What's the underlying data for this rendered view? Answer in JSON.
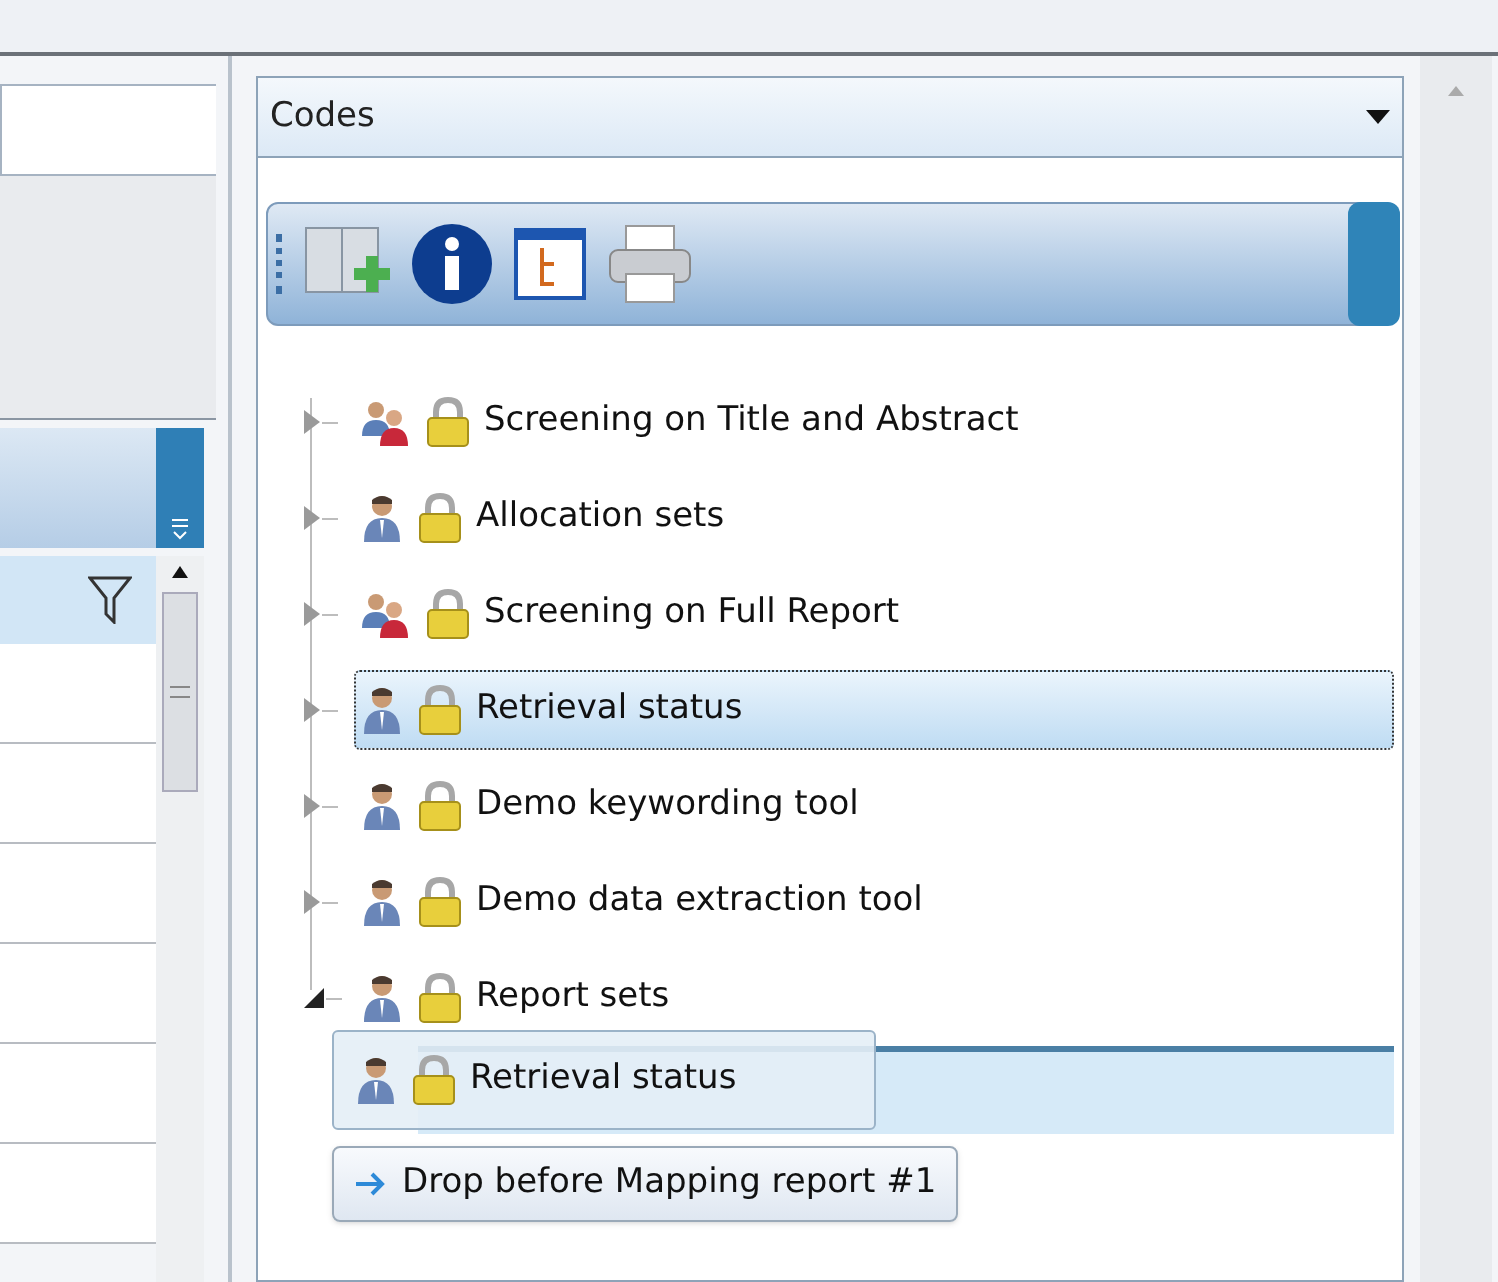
{
  "panel": {
    "title": "Codes"
  },
  "toolbar": {
    "buttons": [
      {
        "kind": "add"
      },
      {
        "kind": "info"
      },
      {
        "kind": "tree"
      },
      {
        "kind": "print"
      }
    ]
  },
  "code_sets": [
    {
      "label": "Screening on Title and Abstract",
      "kind": "multi_user",
      "locked": true,
      "selected": false,
      "expanded": false
    },
    {
      "label": "Allocation sets",
      "kind": "single_user",
      "locked": true,
      "selected": false,
      "expanded": false
    },
    {
      "label": "Screening on Full Report",
      "kind": "multi_user",
      "locked": true,
      "selected": false,
      "expanded": false
    },
    {
      "label": "Retrieval status",
      "kind": "single_user",
      "locked": true,
      "selected": true,
      "expanded": false
    },
    {
      "label": "Demo keywording tool",
      "kind": "single_user",
      "locked": true,
      "selected": false,
      "expanded": false
    },
    {
      "label": "Demo data extraction tool",
      "kind": "single_user",
      "locked": true,
      "selected": false,
      "expanded": false
    },
    {
      "label": "Report sets",
      "kind": "single_user",
      "locked": true,
      "selected": false,
      "expanded": true
    }
  ],
  "drag": {
    "label": "Retrieval status",
    "kind": "single_user",
    "locked": true
  },
  "drop_hint": {
    "text": "Drop before Mapping report #1"
  }
}
